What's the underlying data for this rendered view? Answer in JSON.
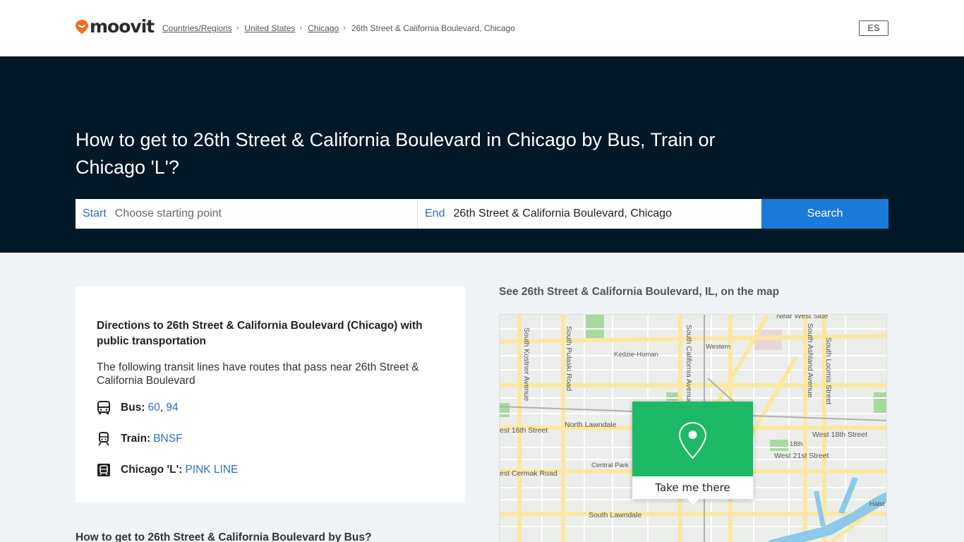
{
  "header": {
    "logo_text": "moovit",
    "breadcrumbs": [
      {
        "label": "Countries/Regions",
        "link": true
      },
      {
        "label": "United States",
        "link": true
      },
      {
        "label": "Chicago",
        "link": true
      },
      {
        "label": "26th Street & California Boulevard, Chicago",
        "link": false
      }
    ],
    "language_button": "ES"
  },
  "hero": {
    "title": "How to get to 26th Street & California Boulevard in Chicago by Bus, Train or Chicago 'L'?",
    "start_label": "Start",
    "start_placeholder": "Choose starting point",
    "end_label": "End",
    "end_value": "26th Street & California Boulevard, Chicago",
    "search_button": "Search"
  },
  "directions": {
    "title": "Directions to 26th Street & California Boulevard (Chicago) with public transportation",
    "description": "The following transit lines have routes that pass near 26th Street & California Boulevard",
    "bus_label": "Bus:",
    "bus_lines": [
      "60",
      "94"
    ],
    "train_label": "Train:",
    "train_lines": [
      "BNSF"
    ],
    "l_label": "Chicago 'L':",
    "l_lines": [
      "PINK LINE"
    ],
    "next_section": "How to get to 26th Street & California Boulevard by Bus?"
  },
  "map": {
    "title": "See 26th Street & California Boulevard, IL, on the map",
    "labels": {
      "kostner": "South Kostner Avenue",
      "pulaski": "South Pulaski Road",
      "california": "South California Avenue",
      "ashland": "South Ashland Avenue",
      "loomis": "South Loomis Street",
      "west_side": "Near West Side",
      "kedzie": "Kedzie-Homan",
      "western": "Western",
      "w16": "est 16th Street",
      "n_lawndale": "North Lawndale",
      "w18": "West 18th Street",
      "eighteenth": "18th",
      "w21": "West 21st Street",
      "cermak": "est Cermak Road",
      "central_park": "Central Park",
      "s_lawndale": "South Lawndale",
      "halsted": "Halst"
    },
    "popup_button": "Take me there"
  },
  "colors": {
    "hero_bg": "#011826",
    "accent": "#1a7ad8",
    "map_pin_green": "#1eb964",
    "logo_orange": "#f26e21"
  }
}
